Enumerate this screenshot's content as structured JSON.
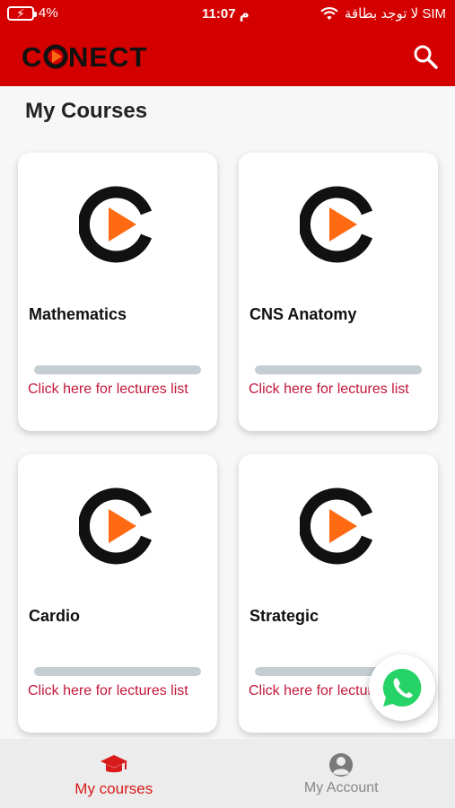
{
  "status_bar": {
    "battery": "4%",
    "time": "11:07 م",
    "carrier": "لا توجد بطاقة SIM"
  },
  "app_bar": {
    "logo_text": "CONNECT",
    "search_icon": "search-icon"
  },
  "main": {
    "title": "My Courses",
    "courses": [
      {
        "name": "Mathematics",
        "link": "Click here for lectures list",
        "progress": 0
      },
      {
        "name": "CNS Anatomy",
        "link": "Click here for lectures list",
        "progress": 0
      },
      {
        "name": "Cardio",
        "link": "Click here for lectures list",
        "progress": 0
      },
      {
        "name": "Strategic",
        "link": "Click here for lectures list",
        "progress": 0
      }
    ]
  },
  "bottom_nav": {
    "items": [
      {
        "label": "My courses",
        "icon": "graduation-cap-icon",
        "active": true
      },
      {
        "label": "My Account",
        "icon": "account-icon",
        "active": false
      }
    ]
  },
  "colors": {
    "brand_red": "#d40000",
    "link_red": "#c2183a",
    "logo_orange": "#ff6a13",
    "whatsapp_green": "#25d366"
  }
}
